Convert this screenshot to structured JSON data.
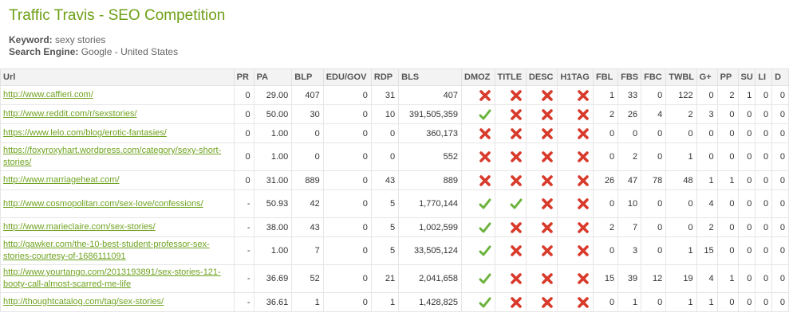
{
  "app": {
    "title": "Traffic Travis - SEO Competition",
    "keyword_label": "Keyword:",
    "keyword_value": "sexy stories",
    "engine_label": "Search Engine:",
    "engine_value": "Google - United States"
  },
  "icons": {
    "pass": "check-icon",
    "fail": "cross-icon",
    "pass_color": "#6cb33e",
    "fail_color": "#d83a2b"
  },
  "columns": [
    "Url",
    "PR",
    "PA",
    "BLP",
    "EDU/GOV",
    "RDP",
    "BLS",
    "DMOZ",
    "TITLE",
    "DESC",
    "H1TAG",
    "FBL",
    "FBS",
    "FBC",
    "TWBL",
    "G+",
    "PP",
    "SU",
    "LI",
    "D"
  ],
  "rows": [
    {
      "url": "http://www.caffieri.com/",
      "pr": "0",
      "pa": "29.00",
      "blp": "407",
      "edu": "0",
      "rdp": "31",
      "bls": "407",
      "dmoz": false,
      "title": false,
      "desc": false,
      "h1": false,
      "fbl": "1",
      "fbs": "33",
      "fbc": "0",
      "twbl": "122",
      "gplus": "0",
      "pp": "2",
      "su": "1",
      "li": "0",
      "d": "0"
    },
    {
      "url": "http://www.reddit.com/r/sexstories/",
      "pr": "0",
      "pa": "50.00",
      "blp": "30",
      "edu": "0",
      "rdp": "10",
      "bls": "391,505,359",
      "dmoz": true,
      "title": false,
      "desc": false,
      "h1": false,
      "fbl": "2",
      "fbs": "26",
      "fbc": "4",
      "twbl": "2",
      "gplus": "3",
      "pp": "0",
      "su": "0",
      "li": "0",
      "d": "0"
    },
    {
      "url": "https://www.lelo.com/blog/erotic-fantasies/",
      "pr": "0",
      "pa": "1.00",
      "blp": "0",
      "edu": "0",
      "rdp": "0",
      "bls": "360,173",
      "dmoz": false,
      "title": false,
      "desc": false,
      "h1": false,
      "fbl": "0",
      "fbs": "0",
      "fbc": "0",
      "twbl": "0",
      "gplus": "0",
      "pp": "0",
      "su": "0",
      "li": "0",
      "d": "0"
    },
    {
      "url": "https://foxyroxyhart.wordpress.com/category/sexy-short-stories/",
      "pr": "0",
      "pa": "1.00",
      "blp": "0",
      "edu": "0",
      "rdp": "0",
      "bls": "552",
      "dmoz": false,
      "title": false,
      "desc": false,
      "h1": false,
      "fbl": "0",
      "fbs": "2",
      "fbc": "0",
      "twbl": "1",
      "gplus": "0",
      "pp": "0",
      "su": "0",
      "li": "0",
      "d": "0"
    },
    {
      "url": "http://www.marriageheat.com/",
      "pr": "0",
      "pa": "31.00",
      "blp": "889",
      "edu": "0",
      "rdp": "43",
      "bls": "889",
      "dmoz": false,
      "title": false,
      "desc": false,
      "h1": false,
      "fbl": "26",
      "fbs": "47",
      "fbc": "78",
      "twbl": "48",
      "gplus": "1",
      "pp": "1",
      "su": "0",
      "li": "0",
      "d": "0"
    },
    {
      "url": "http://www.cosmopolitan.com/sex-love/confessions/",
      "pr": "-",
      "pa": "50.93",
      "blp": "42",
      "edu": "0",
      "rdp": "5",
      "bls": "1,770,144",
      "dmoz": true,
      "title": true,
      "desc": false,
      "h1": false,
      "fbl": "0",
      "fbs": "10",
      "fbc": "0",
      "twbl": "0",
      "gplus": "4",
      "pp": "0",
      "su": "0",
      "li": "0",
      "d": "0"
    },
    {
      "url": "http://www.marieclaire.com/sex-stories/",
      "pr": "-",
      "pa": "38.00",
      "blp": "43",
      "edu": "0",
      "rdp": "5",
      "bls": "1,002,599",
      "dmoz": true,
      "title": false,
      "desc": false,
      "h1": false,
      "fbl": "2",
      "fbs": "7",
      "fbc": "0",
      "twbl": "0",
      "gplus": "2",
      "pp": "0",
      "su": "0",
      "li": "0",
      "d": "0"
    },
    {
      "url": "http://gawker.com/the-10-best-student-professor-sex-stories-courtesy-of-1686111091",
      "pr": "-",
      "pa": "1.00",
      "blp": "7",
      "edu": "0",
      "rdp": "5",
      "bls": "33,505,124",
      "dmoz": true,
      "title": false,
      "desc": false,
      "h1": false,
      "fbl": "0",
      "fbs": "3",
      "fbc": "0",
      "twbl": "1",
      "gplus": "15",
      "pp": "0",
      "su": "0",
      "li": "0",
      "d": "0"
    },
    {
      "url": "http://www.yourtango.com/2013193891/sex-stories-121-booty-call-almost-scarred-me-life",
      "pr": "-",
      "pa": "36.69",
      "blp": "52",
      "edu": "0",
      "rdp": "21",
      "bls": "2,041,658",
      "dmoz": true,
      "title": false,
      "desc": false,
      "h1": false,
      "fbl": "15",
      "fbs": "39",
      "fbc": "12",
      "twbl": "19",
      "gplus": "4",
      "pp": "1",
      "su": "0",
      "li": "0",
      "d": "0"
    },
    {
      "url": "http://thoughtcatalog.com/tag/sex-stories/",
      "pr": "-",
      "pa": "36.61",
      "blp": "1",
      "edu": "0",
      "rdp": "1",
      "bls": "1,428,825",
      "dmoz": true,
      "title": false,
      "desc": false,
      "h1": false,
      "fbl": "0",
      "fbs": "1",
      "fbc": "0",
      "twbl": "1",
      "gplus": "1",
      "pp": "0",
      "su": "0",
      "li": "0",
      "d": "0"
    }
  ]
}
